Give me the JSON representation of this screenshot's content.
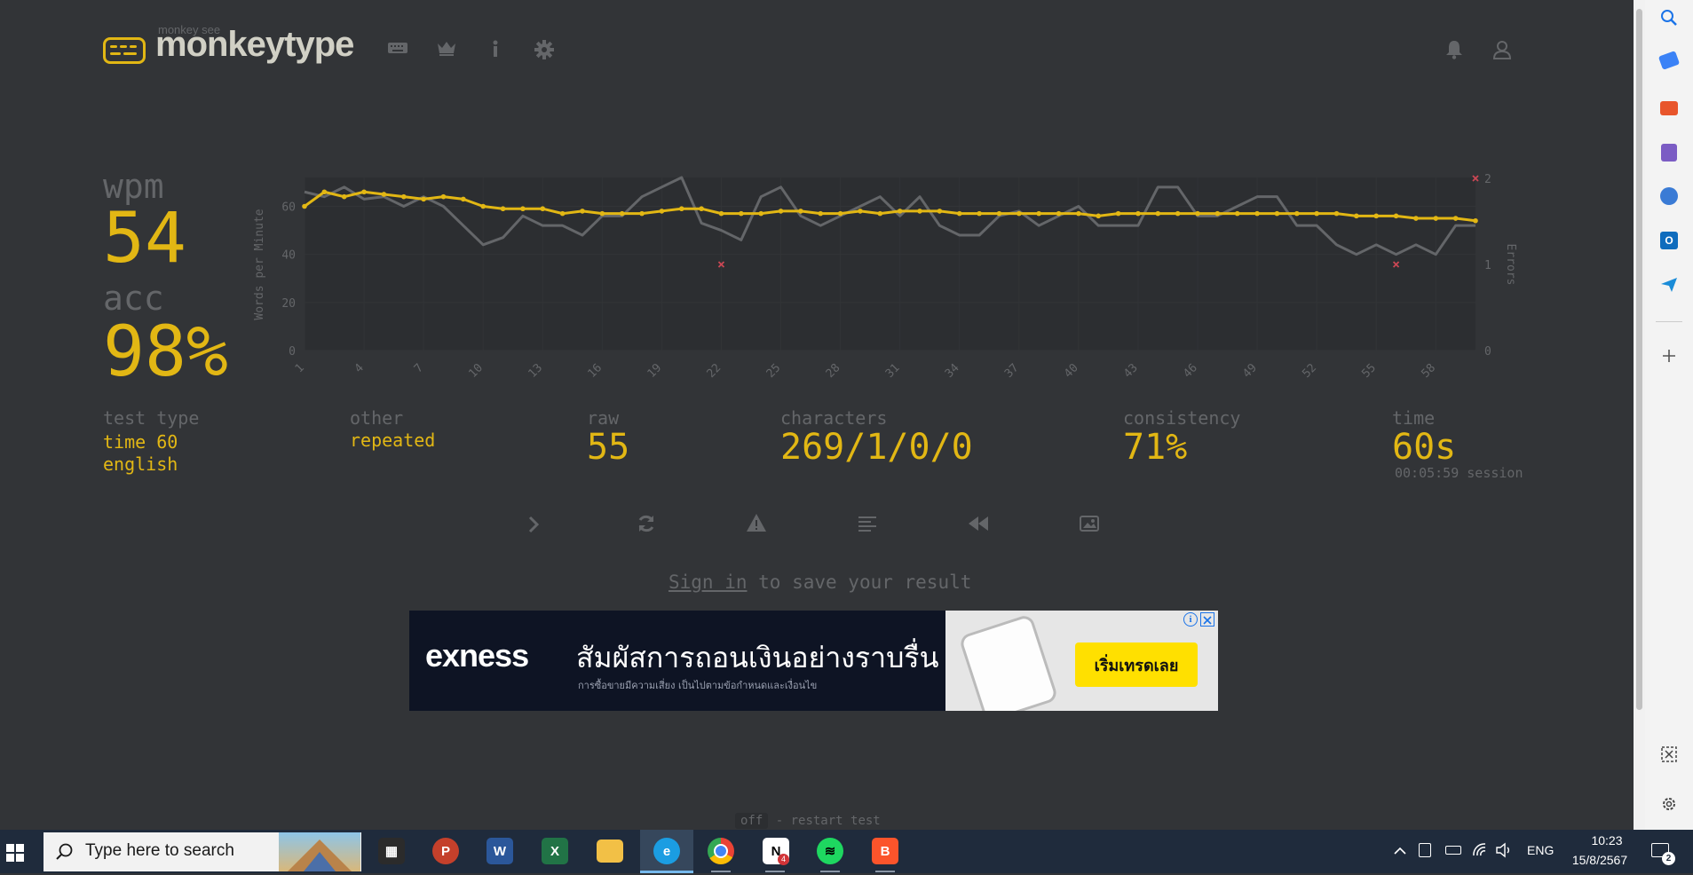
{
  "header": {
    "logo_small": "monkey see",
    "logo_text": "monkeytype",
    "nav": [
      "keyboard-icon",
      "crown-icon",
      "info-icon",
      "gear-icon"
    ],
    "right": [
      "bell-icon",
      "user-icon"
    ]
  },
  "results": {
    "wpm_label": "wpm",
    "wpm_value": "54",
    "acc_label": "acc",
    "acc_value": "98%",
    "test_type_label": "test type",
    "test_type_line1": "time 60",
    "test_type_line2": "english",
    "other_label": "other",
    "other_value": "repeated",
    "raw_label": "raw",
    "raw_value": "55",
    "characters_label": "characters",
    "characters_value": "269/1/0/0",
    "consistency_label": "consistency",
    "consistency_value": "71%",
    "time_label": "time",
    "time_value": "60s",
    "session": "00:05:59 session"
  },
  "chart_data": {
    "type": "line",
    "ylabel": "Words per Minute",
    "y2label": "Errors",
    "ylim": [
      0,
      72
    ],
    "y2lim": [
      0,
      2
    ],
    "yticks": [
      "0",
      "20",
      "40",
      "60"
    ],
    "y2ticks": [
      "0",
      "1",
      "2"
    ],
    "xticks": [
      "1",
      "4",
      "7",
      "10",
      "13",
      "16",
      "19",
      "22",
      "25",
      "28",
      "31",
      "34",
      "37",
      "40",
      "43",
      "46",
      "49",
      "52",
      "55",
      "58"
    ],
    "x": [
      1,
      2,
      3,
      4,
      5,
      6,
      7,
      8,
      9,
      10,
      11,
      12,
      13,
      14,
      15,
      16,
      17,
      18,
      19,
      20,
      21,
      22,
      23,
      24,
      25,
      26,
      27,
      28,
      29,
      30,
      31,
      32,
      33,
      34,
      35,
      36,
      37,
      38,
      39,
      40,
      41,
      42,
      43,
      44,
      45,
      46,
      47,
      48,
      49,
      50,
      51,
      52,
      53,
      54,
      55,
      56,
      57,
      58,
      59,
      60
    ],
    "series": [
      {
        "name": "wpm",
        "color": "#e2b714",
        "values": [
          60,
          66,
          64,
          66,
          65,
          64,
          63,
          64,
          63,
          60,
          59,
          59,
          59,
          57,
          58,
          57,
          57,
          57,
          58,
          59,
          59,
          57,
          57,
          57,
          58,
          58,
          57,
          57,
          58,
          57,
          58,
          58,
          58,
          57,
          57,
          57,
          57,
          57,
          57,
          57,
          56,
          57,
          57,
          57,
          57,
          57,
          57,
          57,
          57,
          57,
          57,
          57,
          57,
          56,
          56,
          56,
          55,
          55,
          55,
          54
        ]
      },
      {
        "name": "raw",
        "color": "#646669",
        "values": [
          66,
          64,
          68,
          63,
          64,
          60,
          64,
          60,
          52,
          44,
          47,
          56,
          52,
          52,
          48,
          56,
          56,
          64,
          68,
          72,
          53,
          50,
          46,
          64,
          68,
          56,
          52,
          56,
          60,
          64,
          56,
          64,
          52,
          48,
          48,
          56,
          58,
          52,
          56,
          60,
          52,
          52,
          52,
          68,
          68,
          56,
          56,
          60,
          64,
          64,
          52,
          52,
          44,
          40,
          44,
          40,
          44,
          40,
          52,
          52
        ]
      },
      {
        "name": "errors",
        "color": "#ca4754",
        "points": [
          [
            22,
            1
          ],
          [
            56,
            1
          ],
          [
            60,
            2
          ]
        ]
      }
    ]
  },
  "actions": [
    "next-test-icon",
    "restart-icon",
    "report-icon",
    "words-history-icon",
    "replay-icon",
    "screenshot-icon"
  ],
  "signin": {
    "link": "Sign in",
    "rest": " to save your result"
  },
  "ad": {
    "brand": "exness",
    "headline": "สัมผัสการถอนเงินอย่างราบรื่น",
    "subtext": "การซื้อขายมีความเสี่ยง เป็นไปตามข้อกำหนดและเงื่อนไข",
    "cta": "เริ่มเทรดเลย"
  },
  "hint": {
    "key": "off",
    "text": " - restart test"
  },
  "taskbar": {
    "search_placeholder": "Type here to search",
    "apps": [
      "calculator-icon",
      "powerpoint-icon",
      "word-icon",
      "excel-icon",
      "file-explorer-icon",
      "edge-icon",
      "chrome-icon",
      "notion-icon",
      "spotify-icon",
      "brave-icon"
    ],
    "notion_badge": "4",
    "lang": "ENG",
    "time": "10:23",
    "date": "15/8/2567",
    "notif_badge": "2"
  },
  "colors": {
    "bg": "#323437",
    "main": "#e2b714",
    "sub": "#646669",
    "text": "#d1d0c5",
    "error": "#ca4754"
  }
}
